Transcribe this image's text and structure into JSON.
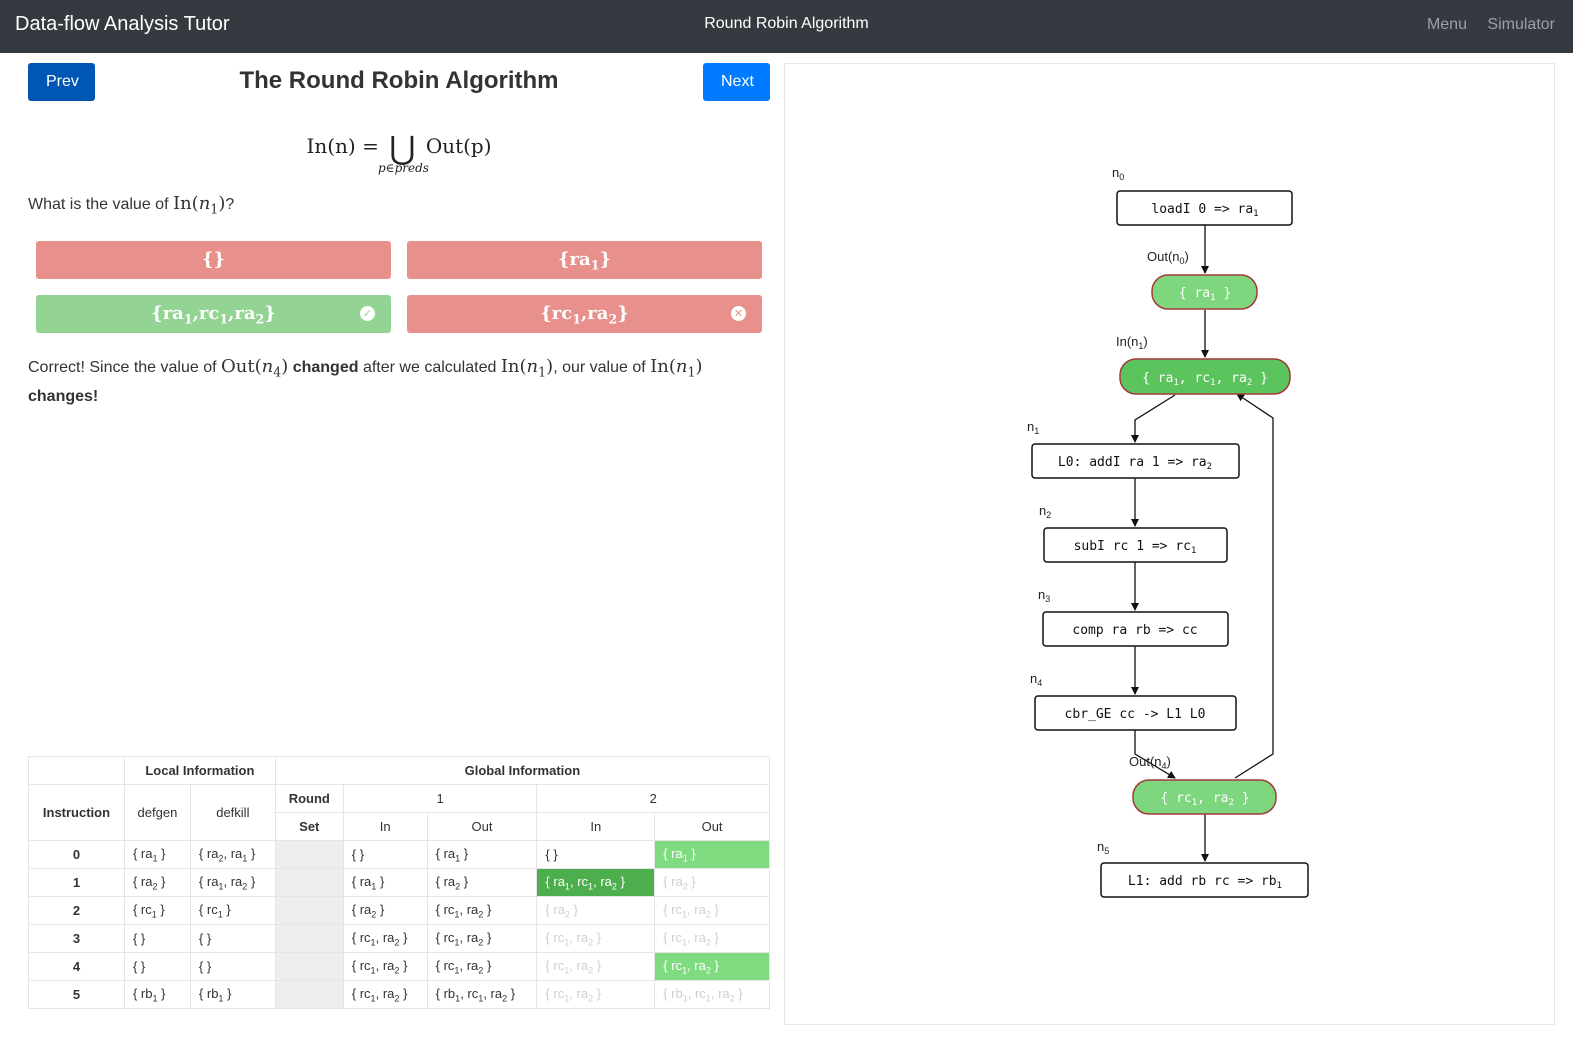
{
  "nav": {
    "brand": "Data-flow Analysis Tutor",
    "center": "Round Robin Algorithm",
    "menu": "Menu",
    "simulator": "Simulator"
  },
  "lesson": {
    "title": "The Round Robin Algorithm",
    "prev_label": "Prev",
    "next_label": "Next",
    "formula": {
      "lhs": "In(n) =",
      "union": "⋃",
      "rhs": "Out(p)",
      "subscript": "p∈preds"
    },
    "question_prefix": "What is the value of",
    "question_suffix": "?",
    "options": [
      {
        "label": "{}",
        "state": "wrong"
      },
      {
        "label": "{ra1}",
        "state": "wrong"
      },
      {
        "label": "{ra1,rc1,ra2}",
        "state": "correct"
      },
      {
        "label": "{rc1,ra2}",
        "state": "wrong"
      }
    ],
    "feedback": {
      "p1": "Correct! Since the value of",
      "bold1": "changed",
      "p2": "after we calculated",
      "p3": ", our value of",
      "bold2": "changes!"
    }
  },
  "table": {
    "local_header": "Local Information",
    "global_header": "Global Information",
    "instruction_header": "Instruction",
    "defgen_header": "defgen",
    "defkill_header": "defkill",
    "round_header": "Round",
    "set_header": "Set",
    "round_1": "1",
    "round_2": "2",
    "in_label": "In",
    "out_label": "Out",
    "rows": [
      {
        "inst": "0",
        "defgen": "{ ra1 }",
        "defkill": "{ ra2, ra1 }",
        "in1": "{ }",
        "out1": "{ ra1 }",
        "in2": "{ }",
        "out2": "{ ra1 }"
      },
      {
        "inst": "1",
        "defgen": "{ ra2 }",
        "defkill": "{ ra1, ra2 }",
        "in1": "{ ra1 }",
        "out1": "{ ra2 }",
        "in2": "{ ra1, rc1, ra2 }",
        "out2": "{ ra2 }"
      },
      {
        "inst": "2",
        "defgen": "{ rc1 }",
        "defkill": "{ rc1 }",
        "in1": "{ ra2 }",
        "out1": "{ rc1, ra2 }",
        "in2": "{ ra2 }",
        "out2": "{ rc1, ra2 }"
      },
      {
        "inst": "3",
        "defgen": "{ }",
        "defkill": "{ }",
        "in1": "{ rc1, ra2 }",
        "out1": "{ rc1, ra2 }",
        "in2": "{ rc1, ra2 }",
        "out2": "{ rc1, ra2 }"
      },
      {
        "inst": "4",
        "defgen": "{ }",
        "defkill": "{ }",
        "in1": "{ rc1, ra2 }",
        "out1": "{ rc1, ra2 }",
        "in2": "{ rc1, ra2 }",
        "out2": "{ rc1, ra2 }"
      },
      {
        "inst": "5",
        "defgen": "{ rb1 }",
        "defkill": "{ rb1 }",
        "in1": "{ rc1, ra2 }",
        "out1": "{ rb1, rc1, ra2 }",
        "in2": "{ rc1, ra2 }",
        "out2": "{ rb1, rc1, ra2 }"
      }
    ]
  },
  "graph": {
    "nodes": [
      {
        "id": "n0",
        "label": "n0",
        "code": "loadI 0  => ra1"
      },
      {
        "id": "n1",
        "label": "n1",
        "code": "L0: addI ra 1 => ra2"
      },
      {
        "id": "n2",
        "label": "n2",
        "code": "subI rc 1 => rc1"
      },
      {
        "id": "n3",
        "label": "n3",
        "code": "comp ra rb => cc"
      },
      {
        "id": "n4",
        "label": "n4",
        "code": "cbr_GE cc  -> L1 L0"
      },
      {
        "id": "n5",
        "label": "n5",
        "code": "L1: add rb rc => rb1"
      }
    ],
    "sets": [
      {
        "id": "out_n0",
        "caption": "Out(n0)",
        "value": "{ ra1 }"
      },
      {
        "id": "in_n1",
        "caption": "In(n1)",
        "value": "{ ra1, rc1, ra2 }"
      },
      {
        "id": "out_n4",
        "caption": "Out(n4)",
        "value": "{ rc1, ra2 }"
      }
    ],
    "colors": {
      "set_fill": "#7ed67e",
      "set_active_fill": "#5cc45c",
      "set_stroke": "#a33a3a",
      "edge": "#111111"
    }
  }
}
